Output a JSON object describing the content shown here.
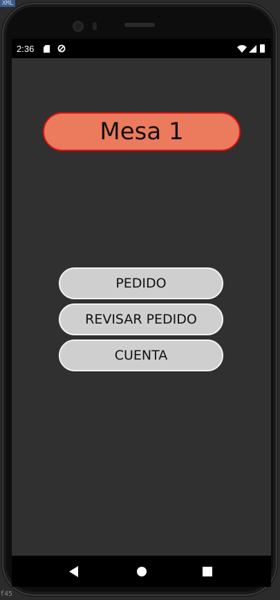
{
  "ide": {
    "top_tag": "XML",
    "bottom_code": "f45"
  },
  "status_bar": {
    "time": "2:36",
    "icons": [
      "sd-card-icon",
      "sync-icon",
      "wifi-icon",
      "signal-icon",
      "battery-icon"
    ]
  },
  "main": {
    "title": "Mesa 1",
    "buttons": [
      {
        "label": "PEDIDO"
      },
      {
        "label": "REVISAR PEDIDO"
      },
      {
        "label": "CUENTA"
      }
    ]
  },
  "nav_bar": {
    "icons": [
      "back-icon",
      "home-icon",
      "recents-icon"
    ]
  },
  "colors": {
    "title_fill": "#ec7a5c",
    "title_border": "#e01010",
    "button_fill": "#cfcfcf",
    "button_border": "#f2f2f2",
    "screen_bg": "#303030"
  }
}
